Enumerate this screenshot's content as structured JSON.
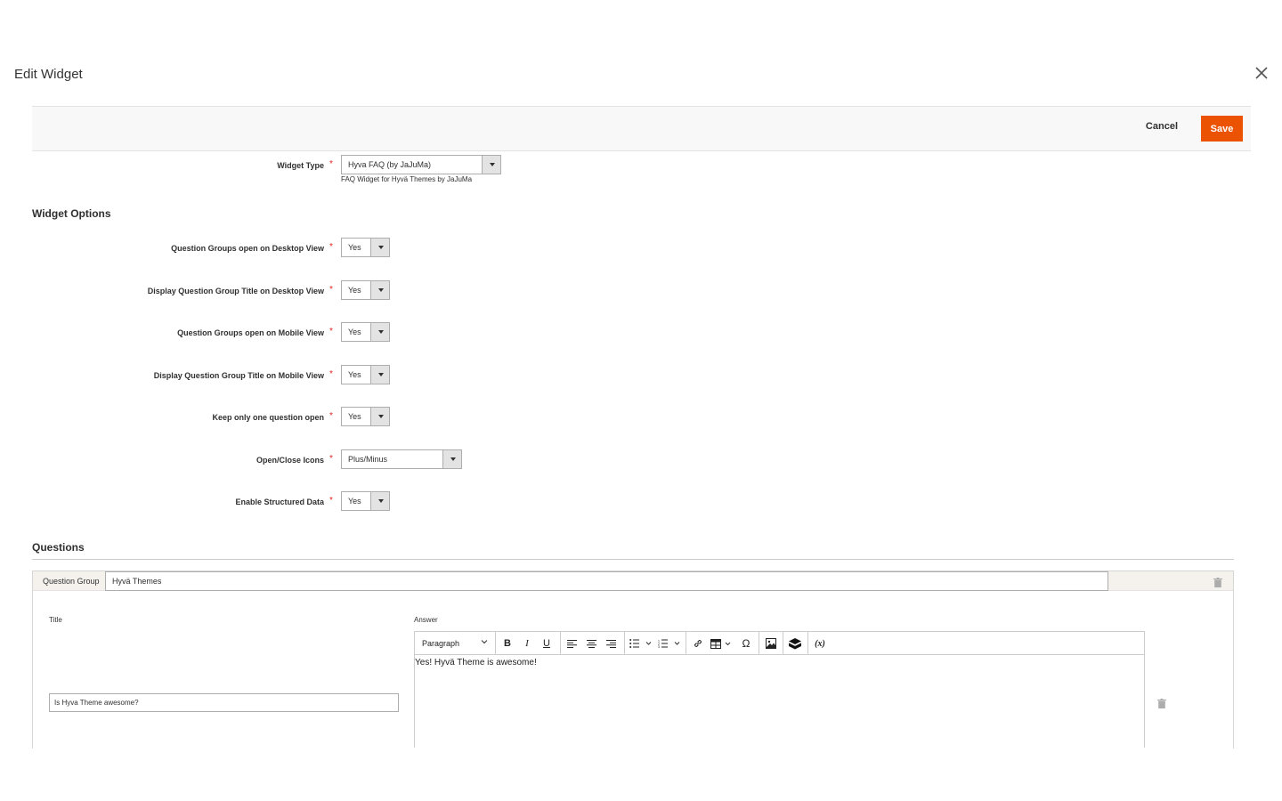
{
  "modal": {
    "title": "Edit Widget"
  },
  "actions": {
    "cancel": "Cancel",
    "save": "Save"
  },
  "widget_type": {
    "label": "Widget Type",
    "value": "Hyva FAQ (by JaJuMa)",
    "note": "FAQ Widget for Hyvä Themes by JaJuMa"
  },
  "widget_options": {
    "title": "Widget Options",
    "fields": [
      {
        "label": "Question Groups open on Desktop View",
        "value": "Yes"
      },
      {
        "label": "Display Question Group Title on Desktop View",
        "value": "Yes"
      },
      {
        "label": "Question Groups open on Mobile View",
        "value": "Yes"
      },
      {
        "label": "Display Question Group Title on Mobile View",
        "value": "Yes"
      },
      {
        "label": "Keep only one question open",
        "value": "Yes"
      },
      {
        "label": "Open/Close Icons",
        "value": "Plus/Minus"
      },
      {
        "label": "Enable Structured Data",
        "value": "Yes"
      }
    ]
  },
  "questions": {
    "title": "Questions",
    "group_label": "Question Group",
    "group_value": "Hyvä Themes",
    "title_label": "Title",
    "answer_label": "Answer",
    "title_value": "Is Hyva Theme awesome?",
    "answer_text": "Yes! Hyvä Theme is awesome!",
    "editor": {
      "paragraph": "Paragraph",
      "bold": "B",
      "italic": "I",
      "underline": "U",
      "special_char": "Ω",
      "variable": "(x)"
    }
  },
  "colors": {
    "accent": "#eb5202",
    "required": "#e22626",
    "action_bar": "#f8f8f8"
  }
}
